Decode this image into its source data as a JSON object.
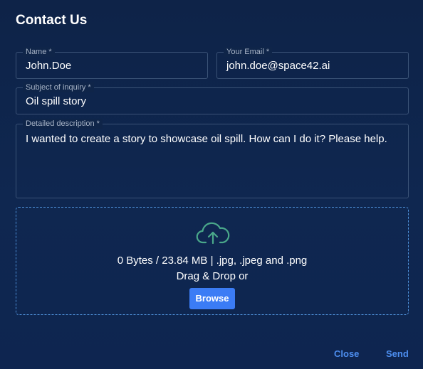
{
  "dialog": {
    "title": "Contact Us"
  },
  "form": {
    "name": {
      "label": "Name *",
      "value": "John.Doe"
    },
    "email": {
      "label": "Your Email *",
      "value": "john.doe@space42.ai"
    },
    "subject": {
      "label": "Subject of inquiry *",
      "value": "Oil spill story"
    },
    "description": {
      "label": "Detailed description *",
      "value": "I wanted to create a story to showcase oil spill. How can I do it? Please help."
    }
  },
  "upload": {
    "icon": "cloud-upload-icon",
    "info": "0 Bytes / 23.84 MB | .jpg, .jpeg and .png",
    "drag_text": "Drag & Drop or",
    "browse_label": "Browse",
    "icon_color": "#4aa88a",
    "border_color": "#4d8ed6"
  },
  "footer": {
    "close_label": "Close",
    "send_label": "Send",
    "accent_color": "#4d8ef0"
  }
}
